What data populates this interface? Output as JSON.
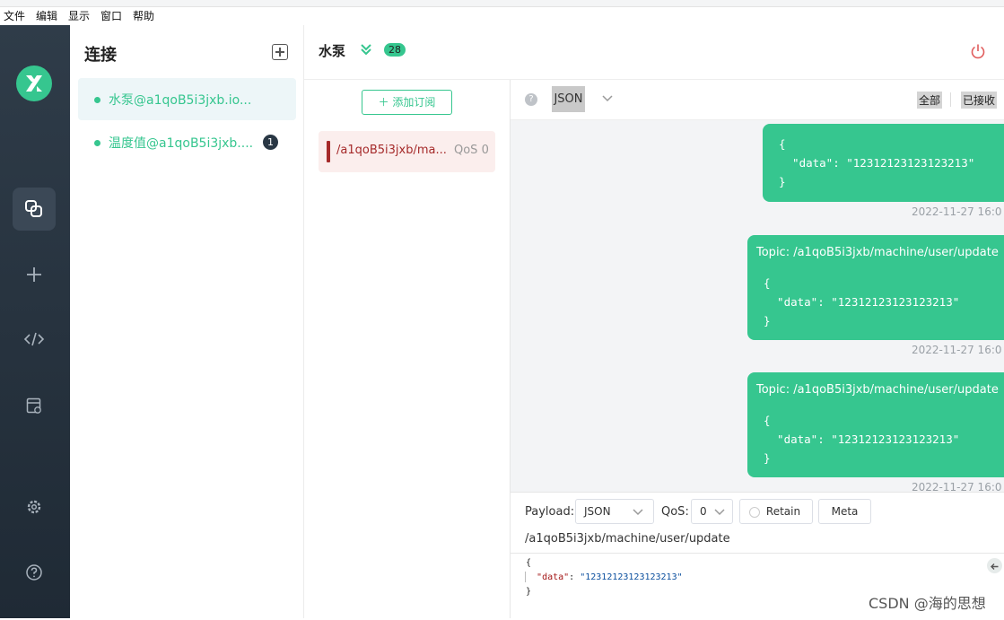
{
  "menu": [
    "文件",
    "编辑",
    "显示",
    "窗口",
    "帮助"
  ],
  "connections": {
    "title": "连接",
    "items": [
      {
        "name": "水泵@a1qoB5i3jxb.io...",
        "status_color": "#36c68f",
        "active": true
      },
      {
        "name": "温度值@a1qoB5i3jxb....",
        "status_color": "#36c68f",
        "unread": "1"
      }
    ]
  },
  "header": {
    "title": "水泵",
    "message_count": "28"
  },
  "subscriptions": {
    "add_label": "添加订阅",
    "items": [
      {
        "topic": "/a1qoB5i3jxb/ma...",
        "qos": "QoS 0",
        "color": "#a52a2a"
      }
    ]
  },
  "filter": {
    "format": "JSON",
    "tabs": [
      "全部",
      "已接收"
    ]
  },
  "messages": [
    {
      "topic": "",
      "payload": "{\n  \"data\": \"12312123123123213\"\n}",
      "time": "2022-11-27 16:0"
    },
    {
      "topic": "Topic: /a1qoB5i3jxb/machine/user/update",
      "payload": "{\n  \"data\": \"12312123123123213\"\n}",
      "time": "2022-11-27 16:0"
    },
    {
      "topic": "Topic: /a1qoB5i3jxb/machine/user/update",
      "payload": "{\n  \"data\": \"12312123123123213\"\n}",
      "time": "2022-11-27 16:0"
    }
  ],
  "composer": {
    "payload_label": "Payload:",
    "payload_format": "JSON",
    "qos_label": "QoS:",
    "qos_value": "0",
    "retain_label": "Retain",
    "meta_label": "Meta",
    "topic": "/a1qoB5i3jxb/machine/user/update",
    "editor": {
      "open": "{",
      "key": "\"data\"",
      "colon": ": ",
      "value": "\"12312123123123213\"",
      "close": "}"
    }
  },
  "watermark": "CSDN @海的思想",
  "colors": {
    "accent": "#36c68f",
    "sidebar": "#2b3744",
    "topic_red": "#a52a2a"
  },
  "icons": [
    "mqttx-logo-icon",
    "connections-icon",
    "plus-icon",
    "code-icon",
    "log-icon",
    "gear-icon",
    "help-icon",
    "double-chevron-down-icon",
    "power-icon",
    "help-circle-icon",
    "chevron-down-icon",
    "arrow-left-icon"
  ]
}
